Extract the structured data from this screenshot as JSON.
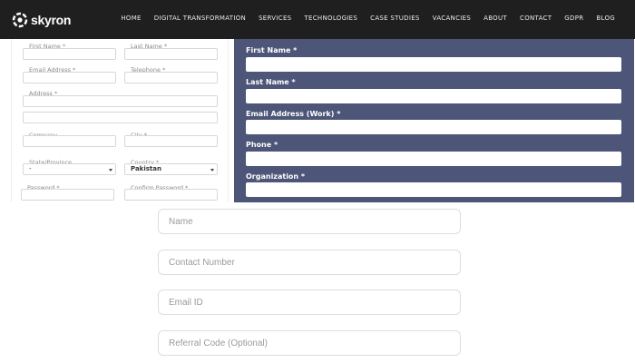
{
  "header": {
    "logo_text": "skyron",
    "logo_icon": "skyron-logo-icon",
    "nav": [
      "HOME",
      "DIGITAL TRANSFORMATION",
      "SERVICES",
      "TECHNOLOGIES",
      "CASE STUDIES",
      "VACANCIES",
      "ABOUT",
      "CONTACT",
      "GDPR",
      "BLOG"
    ]
  },
  "left_form": {
    "first_name": "First Name *",
    "last_name": "Last Name *",
    "email": "Email Address *",
    "telephone": "Telephone *",
    "address": "Address *",
    "company": "Company",
    "city": "City *",
    "state": "State/Province",
    "state_value": "-",
    "country": "Country *",
    "country_value": "Pakistan",
    "password": "Password *",
    "confirm_password": "Confirm Password *"
  },
  "right_form": {
    "background": "#4d5578",
    "first_name": "First Name *",
    "last_name": "Last Name *",
    "email_work": "Email Address (Work) *",
    "phone": "Phone *",
    "organization": "Organization *"
  },
  "bottom_form": {
    "name_placeholder": "Name",
    "contact_placeholder": "Contact Number",
    "email_placeholder": "Email ID",
    "referral_placeholder": "Referral Code (Optional)"
  }
}
